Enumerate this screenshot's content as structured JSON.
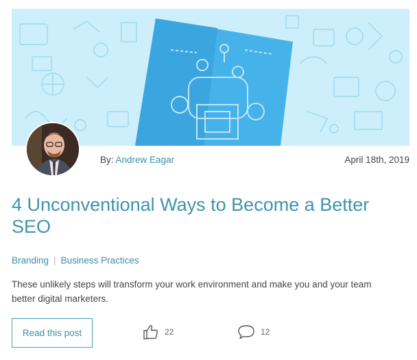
{
  "post": {
    "author_prefix": "By:",
    "author_name": "Andrew Eagar",
    "date": "April 18th, 2019",
    "title": "4 Unconventional Ways to Become a Better SEO",
    "categories": [
      "Branding",
      "Business Practices"
    ],
    "excerpt": "These unlikely steps will transform your work environment and make you and your team better digital marketers.",
    "read_label": "Read this post",
    "likes": "22",
    "comments": "12"
  },
  "icons": {
    "like": "thumbs-up-icon",
    "comment": "speech-bubble-icon"
  },
  "colors": {
    "accent": "#3f93ac",
    "hero_bg": "#cdeefb",
    "hero_card": "#45b2ea"
  }
}
